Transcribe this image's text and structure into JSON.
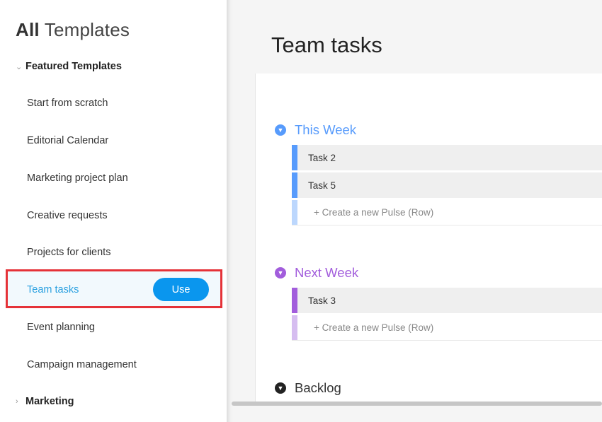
{
  "sidebar": {
    "title_bold": "All",
    "title_rest": "Templates",
    "sections": [
      {
        "label": "Featured Templates",
        "chevron": "v",
        "expanded": true
      },
      {
        "label": "Marketing",
        "chevron": ">",
        "expanded": false
      }
    ],
    "items": [
      {
        "label": "Start from scratch"
      },
      {
        "label": "Editorial Calendar"
      },
      {
        "label": "Marketing project plan"
      },
      {
        "label": "Creative requests"
      },
      {
        "label": "Projects for clients"
      },
      {
        "label": "Team tasks",
        "selected": true
      },
      {
        "label": "Event planning"
      },
      {
        "label": "Campaign management"
      }
    ],
    "use_button": "Use"
  },
  "main": {
    "title": "Team tasks",
    "groups": [
      {
        "name": "This Week",
        "color": "#579bfc",
        "rows": [
          "Task 2",
          "Task 5"
        ],
        "create": "+ Create a new Pulse (Row)"
      },
      {
        "name": "Next Week",
        "color": "#a25ddc",
        "rows": [
          "Task 3"
        ],
        "create": "+ Create a new Pulse (Row)"
      },
      {
        "name": "Backlog",
        "color": "#222222"
      }
    ]
  },
  "colors": {
    "accent": "#0a96ee",
    "selected_text": "#2aa0e0",
    "highlight_border": "#e53238"
  }
}
